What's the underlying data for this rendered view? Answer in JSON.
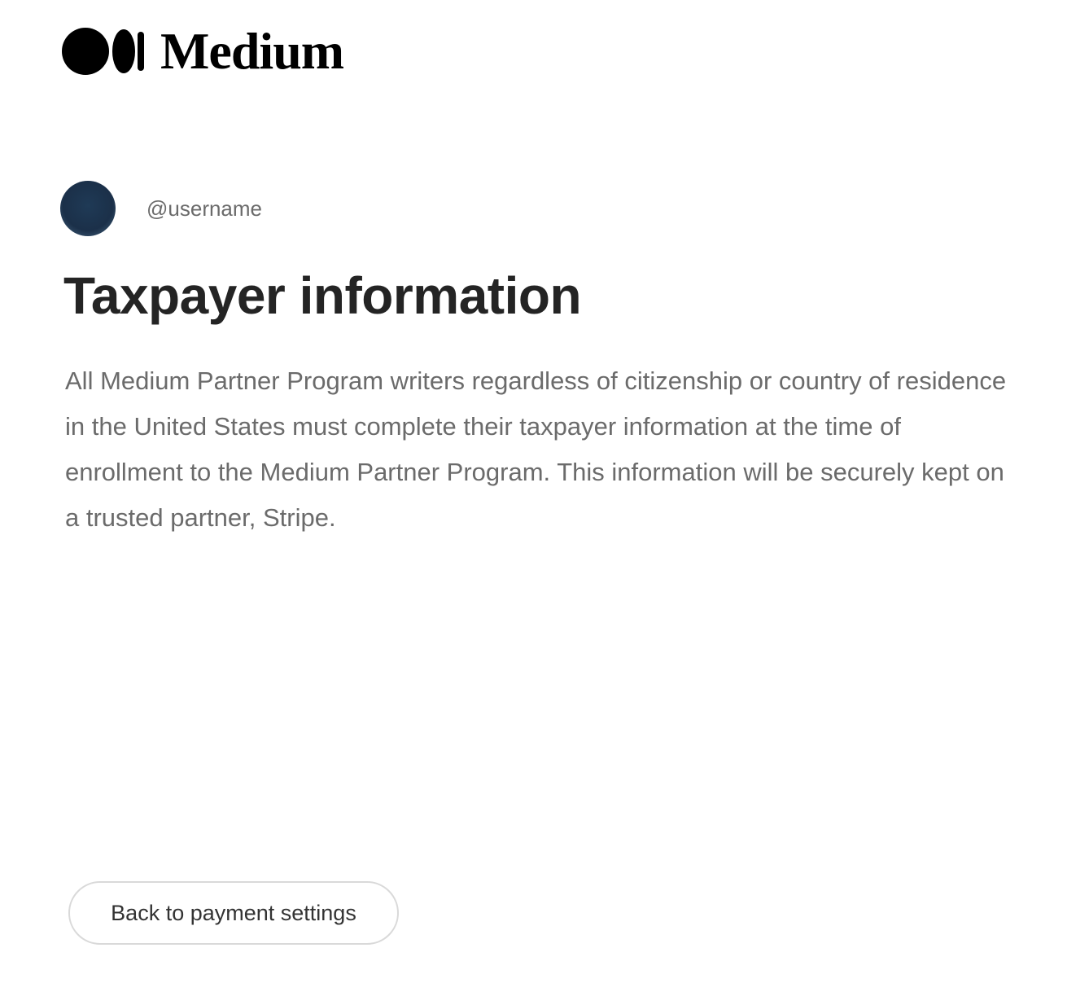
{
  "brand": {
    "logo_icon": "medium-logo-icon",
    "name": "Medium"
  },
  "account": {
    "handle": "@username"
  },
  "page": {
    "title": "Taxpayer information",
    "description": "All Medium Partner Program writers regardless of citizenship or country of residence in the United States must complete their taxpayer information at the time of enrollment to the Medium Partner Program. This information will be securely kept on a trusted partner, Stripe."
  },
  "actions": {
    "primary_label": "Back to payment settings"
  },
  "colors": {
    "background": "#ffffff",
    "text_primary": "#242424",
    "text_secondary": "#6b6b6b",
    "avatar": "#1f3a56",
    "button_border": "#d9d9d9"
  }
}
